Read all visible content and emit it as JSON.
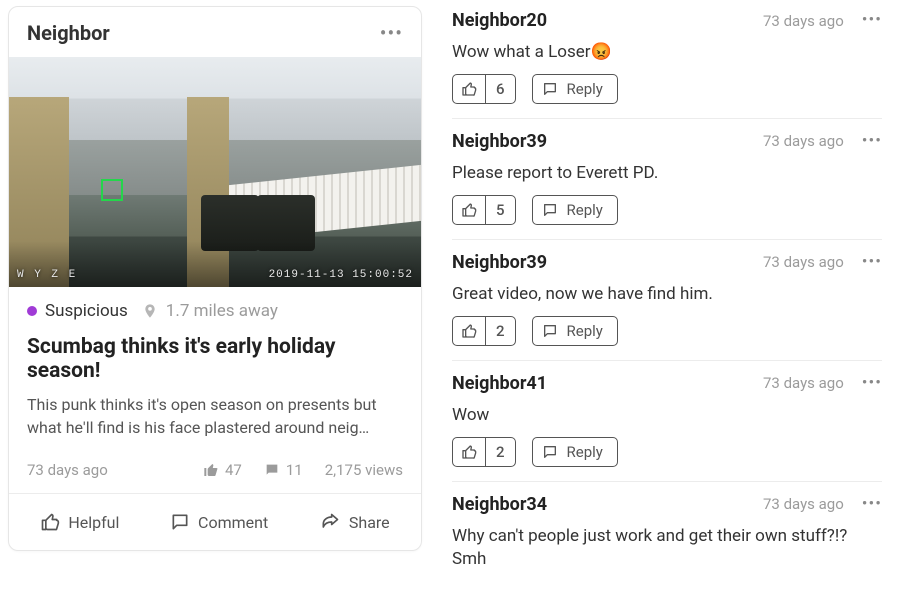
{
  "post": {
    "author": "Neighbor",
    "thumb": {
      "watermark_left": "W Y Z E",
      "watermark_right": "2019-11-13 15:00:52"
    },
    "category_label": "Suspicious",
    "distance": "1.7 miles away",
    "title": "Scumbag thinks it's early holiday season!",
    "body": "This punk thinks it's open season on presents but what he'll find is his face plastered around neig…",
    "age": "73 days ago",
    "likes": "47",
    "comments_count": "11",
    "views": "2,175 views",
    "actions": {
      "helpful": "Helpful",
      "comment": "Comment",
      "share": "Share"
    }
  },
  "reply_label": "Reply",
  "comments": [
    {
      "author": "Neighbor20",
      "age": "73 days ago",
      "body": "Wow what a Loser😡",
      "likes": "6"
    },
    {
      "author": "Neighbor39",
      "age": "73 days ago",
      "body": "Please report to Everett PD.",
      "likes": "5"
    },
    {
      "author": "Neighbor39",
      "age": "73 days ago",
      "body": "Great video, now we have find him.",
      "likes": "2"
    },
    {
      "author": "Neighbor41",
      "age": "73 days ago",
      "body": "Wow",
      "likes": "2"
    },
    {
      "author": "Neighbor34",
      "age": "73 days ago",
      "body": "Why can't people just work and get their own stuff?!? Smh",
      "likes": ""
    }
  ]
}
